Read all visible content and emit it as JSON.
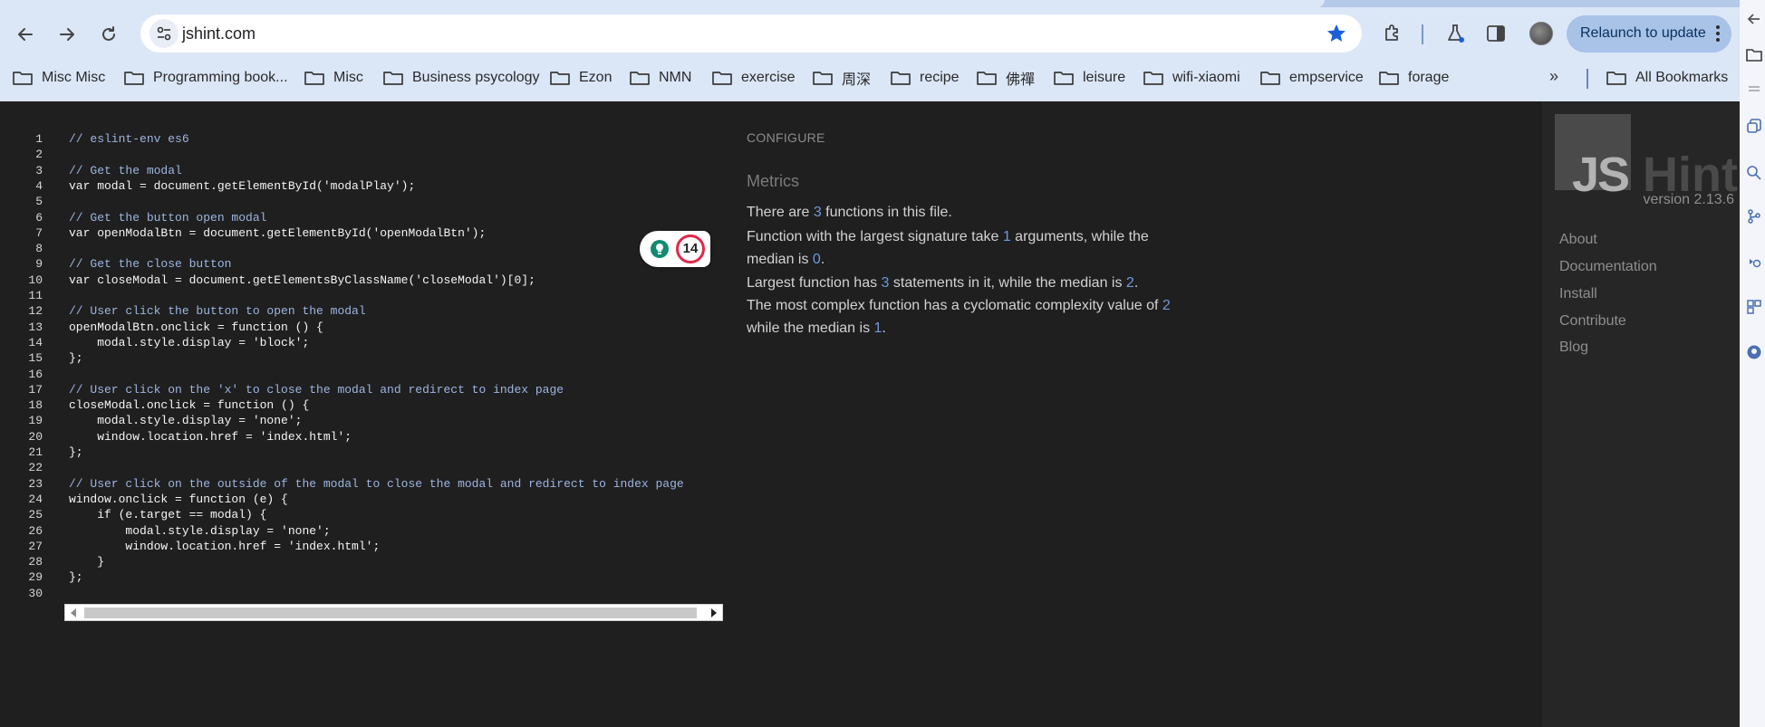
{
  "browser": {
    "url": "jshint.com",
    "relaunch_label": "Relaunch to update",
    "bookmarks": [
      "Misc Misc",
      "Programming book...",
      "Misc",
      "Business psycology",
      "Ezon",
      "NMN",
      "exercise",
      "周深",
      "recipe",
      "佛禪",
      "leisure",
      "wifi-xiaomi",
      "empservice",
      "forage"
    ],
    "more_bookmarks": "»",
    "all_bookmarks": "All Bookmarks"
  },
  "editor": {
    "line_numbers": [
      "1",
      "2",
      "3",
      "4",
      "5",
      "6",
      "7",
      "8",
      "9",
      "10",
      "11",
      "12",
      "13",
      "14",
      "15",
      "16",
      "17",
      "18",
      "19",
      "20",
      "21",
      "22",
      "23",
      "24",
      "25",
      "26",
      "27",
      "28",
      "29",
      "30"
    ],
    "lines": [
      "// eslint-env es6",
      "",
      "// Get the modal",
      "var modal = document.getElementById('modalPlay');",
      "",
      "// Get the button open modal",
      "var openModalBtn = document.getElementById('openModalBtn');",
      "",
      "// Get the close button",
      "var closeModal = document.getElementsByClassName('closeModal')[0];",
      "",
      "// User click the button to open the modal",
      "openModalBtn.onclick = function () {",
      "    modal.style.display = 'block';",
      "};",
      "",
      "// User click on the 'x' to close the modal and redirect to index page",
      "closeModal.onclick = function () {",
      "    modal.style.display = 'none';",
      "    window.location.href = 'index.html';",
      "};",
      "",
      "// User click on the outside of the modal to close the modal and redirect to index page",
      "window.onclick = function (e) {",
      "    if (e.target == modal) {",
      "        modal.style.display = 'none';",
      "        window.location.href = 'index.html';",
      "    }",
      "};",
      ""
    ],
    "lint_count": "14"
  },
  "metrics": {
    "configure": "CONFIGURE",
    "title": "Metrics",
    "p1": {
      "a": "There are ",
      "n1": "3",
      "b": " functions in this file."
    },
    "p2": {
      "a": "Function with the largest signature take ",
      "n1": "1",
      "b": " arguments, while the median is ",
      "n2": "0",
      "c": "."
    },
    "p3": {
      "a": "Largest function has ",
      "n1": "3",
      "b": " statements in it, while the median is ",
      "n2": "2",
      "c": "."
    },
    "p4": {
      "a": "The most complex function has a cyclomatic complexity value of ",
      "n1": "2",
      "b": " while the median is ",
      "n2": "1",
      "c": "."
    }
  },
  "sidebar": {
    "logo_js": "JS",
    "logo_hint": "Hint",
    "version": "version 2.13.6",
    "links": [
      "About",
      "Documentation",
      "Install",
      "Contribute",
      "Blog"
    ]
  },
  "colors": {
    "chrome_bg": "#dbe6f7",
    "page_bg": "#1f1f1f",
    "metric_number": "#6f98dc",
    "lint_ring": "#e2284a",
    "bookmark_star": "#1a5fd6"
  },
  "icons": {
    "back": "back-arrow-icon",
    "forward": "forward-arrow-icon",
    "reload": "reload-icon",
    "site_info": "tune-icon",
    "star": "star-icon",
    "extensions": "puzzle-icon",
    "labs": "flask-icon",
    "side_panel": "side-panel-icon",
    "menu": "three-dots-icon",
    "lint": "lightbulb-icon"
  }
}
